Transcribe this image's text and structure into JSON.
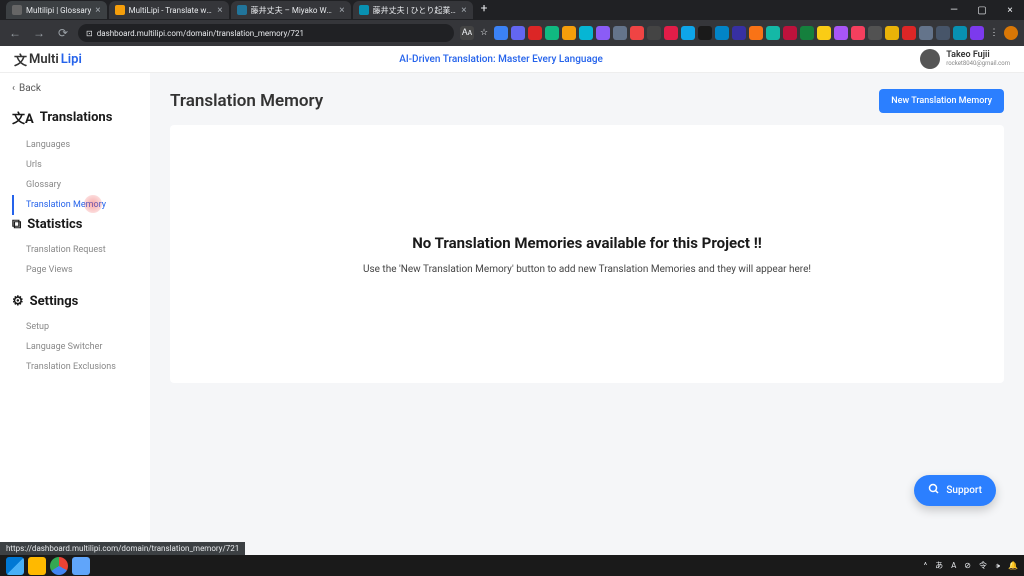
{
  "browser": {
    "tabs": [
      {
        "title": "Multilipi | Glossary",
        "favicon_color": "#666"
      },
      {
        "title": "MultiLipi - Translate websites to",
        "favicon_color": "#f59e0b"
      },
      {
        "title": "藤井丈夫 – Miyako Web Agen…",
        "favicon_color": "#21759b"
      },
      {
        "title": "藤井丈夫 | ひとり起業家専門のW…",
        "favicon_color": "#0891b2"
      }
    ],
    "new_tab": "+",
    "close_glyph": "×",
    "window": {
      "minimize": "—",
      "maximize": "▢",
      "close": "×"
    },
    "nav": {
      "back": "←",
      "forward": "→",
      "reload": "⟳"
    },
    "url": "dashboard.multilipi.com/domain/translation_memory/721",
    "lock": "⊡"
  },
  "header": {
    "logo_prefix": "Multi",
    "logo_suffix": "Lipi",
    "tagline": "AI-Driven Translation: Master Every Language",
    "user_name": "Takeo Fujii",
    "user_email": "rocket8040@gmail.com"
  },
  "sidebar": {
    "back": "Back",
    "sections": [
      {
        "icon": "文A",
        "title": "Translations",
        "items": [
          {
            "label": "Languages",
            "active": false
          },
          {
            "label": "Urls",
            "active": false
          },
          {
            "label": "Glossary",
            "active": false
          },
          {
            "label": "Translation Memory",
            "active": true
          }
        ]
      },
      {
        "icon": "⧉",
        "title": "Statistics",
        "items": [
          {
            "label": "Translation Request",
            "active": false
          },
          {
            "label": "Page Views",
            "active": false
          }
        ]
      },
      {
        "icon": "⚙",
        "title": "Settings",
        "items": [
          {
            "label": "Setup",
            "active": false
          },
          {
            "label": "Language Switcher",
            "active": false
          },
          {
            "label": "Translation Exclusions",
            "active": false
          }
        ]
      }
    ]
  },
  "main": {
    "page_title": "Translation Memory",
    "new_btn": "New Translation Memory",
    "empty_title": "No Translation Memories available for this Project !!",
    "empty_subtitle": "Use the 'New Translation Memory' button to add new Translation Memories and they will appear here!"
  },
  "support": {
    "label": "Support"
  },
  "status_url": "https://dashboard.multilipi.com/domain/translation_memory/721",
  "taskbar": {
    "right": [
      "^",
      "あ",
      "A",
      "⊘",
      "令",
      "🕩",
      "🔔"
    ]
  }
}
